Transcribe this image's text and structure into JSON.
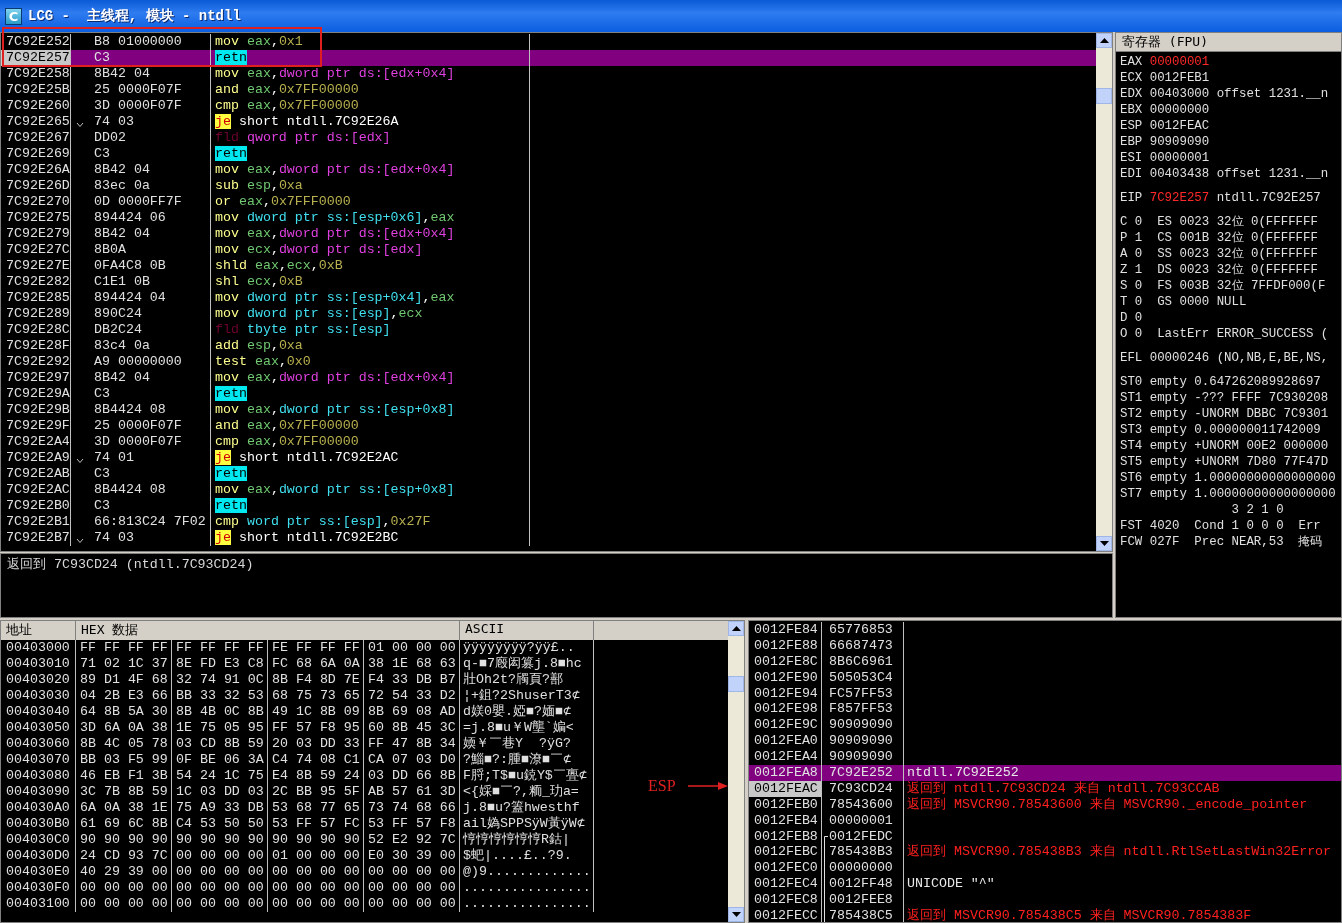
{
  "window": {
    "title": "LCG -  主线程, 模块 - ntdll",
    "icon_letter": "C"
  },
  "disassembly": {
    "rows": [
      {
        "address": "7C92E252",
        "hex": "B8 01000000",
        "boxed": true,
        "selected": false,
        "jump": false,
        "code": [
          {
            "kind": "op",
            "text": "mov"
          },
          {
            "kind": "reg",
            "text": "eax"
          },
          {
            "kind": "punct",
            "text": ","
          },
          {
            "kind": "imm",
            "text": "0x1"
          }
        ]
      },
      {
        "address": "7C92E257",
        "hex": "C3",
        "boxed": true,
        "selected": true,
        "jump": false,
        "code": [
          {
            "kind": "ret",
            "text": "retn"
          }
        ]
      },
      {
        "address": "7C92E258",
        "hex": "8B42 04",
        "boxed": false,
        "selected": false,
        "jump": false,
        "code": [
          {
            "kind": "op",
            "text": "mov"
          },
          {
            "kind": "reg",
            "text": "eax"
          },
          {
            "kind": "punct",
            "text": ","
          },
          {
            "kind": "ds",
            "text": "dword ptr ds:[edx+0x4]"
          }
        ]
      },
      {
        "address": "7C92E25B",
        "hex": "25 0000F07F",
        "boxed": false,
        "selected": false,
        "jump": false,
        "code": [
          {
            "kind": "op",
            "text": "and"
          },
          {
            "kind": "reg",
            "text": "eax"
          },
          {
            "kind": "punct",
            "text": ","
          },
          {
            "kind": "imm",
            "text": "0x7FF00000"
          }
        ]
      },
      {
        "address": "7C92E260",
        "hex": "3D 0000F07F",
        "boxed": false,
        "selected": false,
        "jump": false,
        "code": [
          {
            "kind": "op",
            "text": "cmp"
          },
          {
            "kind": "reg",
            "text": "eax"
          },
          {
            "kind": "punct",
            "text": ","
          },
          {
            "kind": "imm",
            "text": "0x7FF00000"
          }
        ]
      },
      {
        "address": "7C92E265",
        "hex": "74 03",
        "boxed": false,
        "selected": false,
        "jump": true,
        "code": [
          {
            "kind": "jcc",
            "text": "je"
          },
          {
            "kind": "sym",
            "text": "short ntdll.7C92E26A"
          }
        ]
      },
      {
        "address": "7C92E267",
        "hex": "DD02",
        "boxed": false,
        "selected": false,
        "jump": false,
        "code": [
          {
            "kind": "fpu",
            "text": "fld"
          },
          {
            "kind": "ds",
            "text": "qword ptr ds:[edx]"
          }
        ]
      },
      {
        "address": "7C92E269",
        "hex": "C3",
        "boxed": false,
        "selected": false,
        "jump": false,
        "code": [
          {
            "kind": "ret",
            "text": "retn"
          }
        ]
      },
      {
        "address": "7C92E26A",
        "hex": "8B42 04",
        "boxed": false,
        "selected": false,
        "jump": false,
        "code": [
          {
            "kind": "op",
            "text": "mov"
          },
          {
            "kind": "reg",
            "text": "eax"
          },
          {
            "kind": "punct",
            "text": ","
          },
          {
            "kind": "ds",
            "text": "dword ptr ds:[edx+0x4]"
          }
        ]
      },
      {
        "address": "7C92E26D",
        "hex": "83ec 0a",
        "boxed": false,
        "selected": false,
        "jump": false,
        "code": [
          {
            "kind": "op",
            "text": "sub"
          },
          {
            "kind": "reg",
            "text": "esp"
          },
          {
            "kind": "punct",
            "text": ","
          },
          {
            "kind": "imm",
            "text": "0xa"
          }
        ]
      },
      {
        "address": "7C92E270",
        "hex": "0D 0000FF7F",
        "boxed": false,
        "selected": false,
        "jump": false,
        "code": [
          {
            "kind": "op",
            "text": "or"
          },
          {
            "kind": "reg",
            "text": "eax"
          },
          {
            "kind": "punct",
            "text": ","
          },
          {
            "kind": "imm",
            "text": "0x7FFF0000"
          }
        ]
      },
      {
        "address": "7C92E275",
        "hex": "894424 06",
        "boxed": false,
        "selected": false,
        "jump": false,
        "code": [
          {
            "kind": "op",
            "text": "mov"
          },
          {
            "kind": "ss",
            "text": "dword ptr ss:[esp+0x6]"
          },
          {
            "kind": "punct",
            "text": ","
          },
          {
            "kind": "reg",
            "text": "eax"
          }
        ]
      },
      {
        "address": "7C92E279",
        "hex": "8B42 04",
        "boxed": false,
        "selected": false,
        "jump": false,
        "code": [
          {
            "kind": "op",
            "text": "mov"
          },
          {
            "kind": "reg",
            "text": "eax"
          },
          {
            "kind": "punct",
            "text": ","
          },
          {
            "kind": "ds",
            "text": "dword ptr ds:[edx+0x4]"
          }
        ]
      },
      {
        "address": "7C92E27C",
        "hex": "8B0A",
        "boxed": false,
        "selected": false,
        "jump": false,
        "code": [
          {
            "kind": "op",
            "text": "mov"
          },
          {
            "kind": "reg",
            "text": "ecx"
          },
          {
            "kind": "punct",
            "text": ","
          },
          {
            "kind": "ds",
            "text": "dword ptr ds:[edx]"
          }
        ]
      },
      {
        "address": "7C92E27E",
        "hex": "0FA4C8 0B",
        "boxed": false,
        "selected": false,
        "jump": false,
        "code": [
          {
            "kind": "op",
            "text": "shld"
          },
          {
            "kind": "reg",
            "text": "eax"
          },
          {
            "kind": "punct",
            "text": ","
          },
          {
            "kind": "reg",
            "text": "ecx"
          },
          {
            "kind": "punct",
            "text": ","
          },
          {
            "kind": "imm",
            "text": "0xB"
          }
        ]
      },
      {
        "address": "7C92E282",
        "hex": "C1E1 0B",
        "boxed": false,
        "selected": false,
        "jump": false,
        "code": [
          {
            "kind": "op",
            "text": "shl"
          },
          {
            "kind": "reg",
            "text": "ecx"
          },
          {
            "kind": "punct",
            "text": ","
          },
          {
            "kind": "imm",
            "text": "0xB"
          }
        ]
      },
      {
        "address": "7C92E285",
        "hex": "894424 04",
        "boxed": false,
        "selected": false,
        "jump": false,
        "code": [
          {
            "kind": "op",
            "text": "mov"
          },
          {
            "kind": "ss",
            "text": "dword ptr ss:[esp+0x4]"
          },
          {
            "kind": "punct",
            "text": ","
          },
          {
            "kind": "reg",
            "text": "eax"
          }
        ]
      },
      {
        "address": "7C92E289",
        "hex": "890C24",
        "boxed": false,
        "selected": false,
        "jump": false,
        "code": [
          {
            "kind": "op",
            "text": "mov"
          },
          {
            "kind": "ss",
            "text": "dword ptr ss:[esp]"
          },
          {
            "kind": "punct",
            "text": ","
          },
          {
            "kind": "reg",
            "text": "ecx"
          }
        ]
      },
      {
        "address": "7C92E28C",
        "hex": "DB2C24",
        "boxed": false,
        "selected": false,
        "jump": false,
        "code": [
          {
            "kind": "fpu",
            "text": "fld"
          },
          {
            "kind": "ss",
            "text": "tbyte ptr ss:[esp]"
          }
        ]
      },
      {
        "address": "7C92E28F",
        "hex": "83c4 0a",
        "boxed": false,
        "selected": false,
        "jump": false,
        "code": [
          {
            "kind": "op",
            "text": "add"
          },
          {
            "kind": "reg",
            "text": "esp"
          },
          {
            "kind": "punct",
            "text": ","
          },
          {
            "kind": "imm",
            "text": "0xa"
          }
        ]
      },
      {
        "address": "7C92E292",
        "hex": "A9 00000000",
        "boxed": false,
        "selected": false,
        "jump": false,
        "code": [
          {
            "kind": "op",
            "text": "test"
          },
          {
            "kind": "reg",
            "text": "eax"
          },
          {
            "kind": "punct",
            "text": ","
          },
          {
            "kind": "imm",
            "text": "0x0"
          }
        ]
      },
      {
        "address": "7C92E297",
        "hex": "8B42 04",
        "boxed": false,
        "selected": false,
        "jump": false,
        "code": [
          {
            "kind": "op",
            "text": "mov"
          },
          {
            "kind": "reg",
            "text": "eax"
          },
          {
            "kind": "punct",
            "text": ","
          },
          {
            "kind": "ds",
            "text": "dword ptr ds:[edx+0x4]"
          }
        ]
      },
      {
        "address": "7C92E29A",
        "hex": "C3",
        "boxed": false,
        "selected": false,
        "jump": false,
        "code": [
          {
            "kind": "ret",
            "text": "retn"
          }
        ]
      },
      {
        "address": "7C92E29B",
        "hex": "8B4424 08",
        "boxed": false,
        "selected": false,
        "jump": false,
        "code": [
          {
            "kind": "op",
            "text": "mov"
          },
          {
            "kind": "reg",
            "text": "eax"
          },
          {
            "kind": "punct",
            "text": ","
          },
          {
            "kind": "ss",
            "text": "dword ptr ss:[esp+0x8]"
          }
        ]
      },
      {
        "address": "7C92E29F",
        "hex": "25 0000F07F",
        "boxed": false,
        "selected": false,
        "jump": false,
        "code": [
          {
            "kind": "op",
            "text": "and"
          },
          {
            "kind": "reg",
            "text": "eax"
          },
          {
            "kind": "punct",
            "text": ","
          },
          {
            "kind": "imm",
            "text": "0x7FF00000"
          }
        ]
      },
      {
        "address": "7C92E2A4",
        "hex": "3D 0000F07F",
        "boxed": false,
        "selected": false,
        "jump": false,
        "code": [
          {
            "kind": "op",
            "text": "cmp"
          },
          {
            "kind": "reg",
            "text": "eax"
          },
          {
            "kind": "punct",
            "text": ","
          },
          {
            "kind": "imm",
            "text": "0x7FF00000"
          }
        ]
      },
      {
        "address": "7C92E2A9",
        "hex": "74 01",
        "boxed": false,
        "selected": false,
        "jump": true,
        "code": [
          {
            "kind": "jcc",
            "text": "je"
          },
          {
            "kind": "sym",
            "text": "short ntdll.7C92E2AC"
          }
        ]
      },
      {
        "address": "7C92E2AB",
        "hex": "C3",
        "boxed": false,
        "selected": false,
        "jump": false,
        "code": [
          {
            "kind": "ret",
            "text": "retn"
          }
        ]
      },
      {
        "address": "7C92E2AC",
        "hex": "8B4424 08",
        "boxed": false,
        "selected": false,
        "jump": false,
        "code": [
          {
            "kind": "op",
            "text": "mov"
          },
          {
            "kind": "reg",
            "text": "eax"
          },
          {
            "kind": "punct",
            "text": ","
          },
          {
            "kind": "ss",
            "text": "dword ptr ss:[esp+0x8]"
          }
        ]
      },
      {
        "address": "7C92E2B0",
        "hex": "C3",
        "boxed": false,
        "selected": false,
        "jump": false,
        "code": [
          {
            "kind": "ret",
            "text": "retn"
          }
        ]
      },
      {
        "address": "7C92E2B1",
        "hex": "66:813C24 7F02",
        "boxed": false,
        "selected": false,
        "jump": false,
        "code": [
          {
            "kind": "op",
            "text": "cmp"
          },
          {
            "kind": "ss",
            "text": "word ptr ss:[esp]"
          },
          {
            "kind": "punct",
            "text": ","
          },
          {
            "kind": "imm",
            "text": "0x27F"
          }
        ]
      },
      {
        "address": "7C92E2B7",
        "hex": "74 03",
        "boxed": false,
        "selected": false,
        "jump": true,
        "code": [
          {
            "kind": "jcc",
            "text": "je"
          },
          {
            "kind": "sym",
            "text": "short ntdll.7C92E2BC"
          }
        ]
      }
    ]
  },
  "info": "返回到 7C93CD24 (ntdll.7C93CD24)",
  "registers": {
    "title": "寄存器 (FPU)",
    "groups": [
      {
        "lines": [
          {
            "kind": "reg",
            "name": "EAX",
            "value": "00000001",
            "changed": true
          },
          {
            "kind": "reg",
            "name": "ECX",
            "value": "0012FEB1",
            "changed": false
          },
          {
            "kind": "reg",
            "name": "EDX",
            "value": "00403000",
            "changed": false,
            "comment": "offset 1231.__n"
          },
          {
            "kind": "reg",
            "name": "EBX",
            "value": "00000000",
            "changed": false
          },
          {
            "kind": "reg",
            "name": "ESP",
            "value": "0012FEAC",
            "changed": false
          },
          {
            "kind": "reg",
            "name": "EBP",
            "value": "90909090",
            "changed": false
          },
          {
            "kind": "reg",
            "name": "ESI",
            "value": "00000001",
            "changed": false
          },
          {
            "kind": "reg",
            "name": "EDI",
            "value": "00403438",
            "changed": false,
            "comment": "offset 1231.__n"
          }
        ]
      },
      {
        "lines": [
          {
            "kind": "reg",
            "name": "EIP",
            "value": "7C92E257",
            "changed": true,
            "comment": "ntdll.7C92E257"
          }
        ]
      },
      {
        "lines": [
          {
            "kind": "text",
            "text": "C 0  ES 0023 32位 0(FFFFFFF"
          },
          {
            "kind": "text",
            "text": "P 1  CS 001B 32位 0(FFFFFFF"
          },
          {
            "kind": "text",
            "text": "A 0  SS 0023 32位 0(FFFFFFF"
          },
          {
            "kind": "text",
            "text": "Z 1  DS 0023 32位 0(FFFFFFF"
          },
          {
            "kind": "text",
            "text": "S 0  FS 003B 32位 7FFDF000(F"
          },
          {
            "kind": "text",
            "text": "T 0  GS 0000 NULL"
          },
          {
            "kind": "text",
            "text": "D 0"
          },
          {
            "kind": "text",
            "text": "O 0  LastErr ERROR_SUCCESS ("
          }
        ]
      },
      {
        "lines": [
          {
            "kind": "text",
            "text": "EFL 00000246 (NO,NB,E,BE,NS,"
          }
        ]
      },
      {
        "lines": [
          {
            "kind": "text",
            "text": "ST0 empty 0.647262089928697"
          },
          {
            "kind": "text",
            "text": "ST1 empty -??? FFFF 7C930208"
          },
          {
            "kind": "text",
            "text": "ST2 empty -UNORM DBBC 7C9301"
          },
          {
            "kind": "text",
            "text": "ST3 empty 0.000000011742009"
          },
          {
            "kind": "text",
            "text": "ST4 empty +UNORM 00E2 000000"
          },
          {
            "kind": "text",
            "text": "ST5 empty +UNORM 7D80 77F47D"
          },
          {
            "kind": "text",
            "text": "ST6 empty 1.00000000000000000"
          },
          {
            "kind": "text",
            "text": "ST7 empty 1.00000000000000000"
          },
          {
            "kind": "text",
            "text": "               3 2 1 0"
          },
          {
            "kind": "text",
            "text": "FST 4020  Cond 1 0 0 0  Err"
          },
          {
            "kind": "text",
            "text": "FCW 027F  Prec NEAR,53  掩码"
          }
        ]
      }
    ]
  },
  "dump": {
    "columns": [
      "地址",
      "HEX 数据",
      "ASCII"
    ],
    "rows": [
      {
        "address": "00403000",
        "bytes": [
          "FF FF FF FF",
          "FF FF FF FF",
          "FE FF FF FF",
          "01 00 00 00"
        ],
        "ascii": "ÿÿÿÿÿÿÿÿ?ÿÿ£.."
      },
      {
        "address": "00403010",
        "bytes": [
          "71 02 1C 37",
          "8E FD E3 C8",
          "FC 68 6A 0A",
          "38 1E 68 63"
        ],
        "ascii": "q-■7廏闳篡j.8■hc"
      },
      {
        "address": "00403020",
        "bytes": [
          "89 D1 4F 68",
          "32 74 91 0C",
          "8B F4 8D 7E",
          "F4 33 DB B7"
        ],
        "ascii": "壯Oh2t?斶頁?鄯"
      },
      {
        "address": "00403030",
        "bytes": [
          "04 2B E3 66",
          "BB 33 32 53",
          "68 75 73 65",
          "72 54 33 D2"
        ],
        "ascii": "¦+鉏?2ShuserT3⊄"
      },
      {
        "address": "00403040",
        "bytes": [
          "64 8B 5A 30",
          "8B 4B 0C 8B",
          "49 1C 8B 09",
          "8B 69 08 AD"
        ],
        "ascii": "d媄0嬰.婭■?媔■⊄"
      },
      {
        "address": "00403050",
        "bytes": [
          "3D 6A 0A 38",
          "1E 75 05 95",
          "FF 57 F8 95",
          "60 8B 45 3C"
        ],
        "ascii": "=j.8■u￥W壟`媥<"
      },
      {
        "address": "00403060",
        "bytes": [
          "8B 4C 05 78",
          "03 CD 8B 59",
          "20 03 DD 33",
          "FF 47 8B 34"
        ],
        "ascii": "媆￥￣巷Y  ?ÿG?"
      },
      {
        "address": "00403070",
        "bytes": [
          "BB 03 F5 99",
          "0F BE 06 3A",
          "C4 74 08 C1",
          "CA 07 03 D0"
        ],
        "ascii": "?鯔■?:腫■潦■￣⊄"
      },
      {
        "address": "00403080",
        "bytes": [
          "46 EB F1 3B",
          "54 24 1C 75",
          "E4 8B 59 24",
          "03 DD 66 8B"
        ],
        "ascii": "F脟;T$■u鋴Y$￣亹⊄"
      },
      {
        "address": "00403090",
        "bytes": [
          "3C 7B 8B 59",
          "1C 03 DD 03",
          "2C BB 95 5F",
          "AB 57 61 3D"
        ],
        "ascii": "<{婇■￣?,粫_玏a="
      },
      {
        "address": "004030A0",
        "bytes": [
          "6A 0A 38 1E",
          "75 A9 33 DB",
          "53 68 77 65",
          "73 74 68 66"
        ],
        "ascii": "j.8■u?篕hwesthf"
      },
      {
        "address": "004030B0",
        "bytes": [
          "61 69 6C 8B",
          "C4 53 50 50",
          "53 FF 57 FC",
          "53 FF 57 F8"
        ],
        "ascii": "ail媯SPPSÿW黃ÿW⊄"
      },
      {
        "address": "004030C0",
        "bytes": [
          "90 90 90 90",
          "90 90 90 90",
          "90 90 90 90",
          "52 E2 92 7C"
        ],
        "ascii": "悙悙悙悙悙悙R鈷|"
      },
      {
        "address": "004030D0",
        "bytes": [
          "24 CD 93 7C",
          "00 00 00 00",
          "01 00 00 00",
          "E0 30 39 00"
        ],
        "ascii": "$蚆|....£..?9."
      },
      {
        "address": "004030E0",
        "bytes": [
          "40 29 39 00",
          "00 00 00 00",
          "00 00 00 00",
          "00 00 00 00"
        ],
        "ascii": "@)9............."
      },
      {
        "address": "004030F0",
        "bytes": [
          "00 00 00 00",
          "00 00 00 00",
          "00 00 00 00",
          "00 00 00 00"
        ],
        "ascii": "................"
      },
      {
        "address": "00403100",
        "bytes": [
          "00 00 00 00",
          "00 00 00 00",
          "00 00 00 00",
          "00 00 00 00"
        ],
        "ascii": "................"
      }
    ]
  },
  "stack": {
    "pointer_label": "ESP",
    "rows": [
      {
        "address": "0012FE84",
        "value": "65776853",
        "selected": false,
        "current": false,
        "frame": false
      },
      {
        "address": "0012FE88",
        "value": "66687473",
        "selected": false,
        "current": false,
        "frame": false
      },
      {
        "address": "0012FE8C",
        "value": "8B6C6961",
        "selected": false,
        "current": false,
        "frame": false
      },
      {
        "address": "0012FE90",
        "value": "505053C4",
        "selected": false,
        "current": false,
        "frame": false
      },
      {
        "address": "0012FE94",
        "value": "FC57FF53",
        "selected": false,
        "current": false,
        "frame": false
      },
      {
        "address": "0012FE98",
        "value": "F857FF53",
        "selected": false,
        "current": false,
        "frame": false
      },
      {
        "address": "0012FE9C",
        "value": "90909090",
        "selected": false,
        "current": false,
        "frame": false
      },
      {
        "address": "0012FEA0",
        "value": "90909090",
        "selected": false,
        "current": false,
        "frame": false
      },
      {
        "address": "0012FEA4",
        "value": "90909090",
        "selected": false,
        "current": false,
        "frame": false
      },
      {
        "address": "0012FEA8",
        "value": "7C92E252",
        "selected": true,
        "current": false,
        "frame": false,
        "kind": "plain",
        "comment": "ntdll.7C92E252"
      },
      {
        "address": "0012FEAC",
        "value": "7C93CD24",
        "selected": false,
        "current": true,
        "frame": false,
        "kind": "return",
        "comment": "返回到 ntdll.7C93CD24 来自 ntdll.7C93CCAB"
      },
      {
        "address": "0012FEB0",
        "value": "78543600",
        "selected": false,
        "current": false,
        "frame": false,
        "kind": "return",
        "comment": "返回到 MSVCR90.78543600 来自 MSVCR90._encode_pointer"
      },
      {
        "address": "0012FEB4",
        "value": "00000001",
        "selected": false,
        "current": false,
        "frame": false
      },
      {
        "address": "0012FEB8",
        "value": "0012FEDC",
        "selected": false,
        "current": false,
        "frame": true
      },
      {
        "address": "0012FEBC",
        "value": "785438B3",
        "selected": false,
        "current": false,
        "frame": true,
        "kind": "return",
        "comment": "返回到 MSVCR90.785438B3 来自 ntdll.RtlSetLastWin32Error"
      },
      {
        "address": "0012FEC0",
        "value": "00000000",
        "selected": false,
        "current": false,
        "frame": true
      },
      {
        "address": "0012FEC4",
        "value": "0012FF48",
        "selected": false,
        "current": false,
        "frame": true,
        "kind": "plain",
        "comment": "UNICODE \"^\""
      },
      {
        "address": "0012FEC8",
        "value": "0012FEE8",
        "selected": false,
        "current": false,
        "frame": true
      },
      {
        "address": "0012FECC",
        "value": "785438C5",
        "selected": false,
        "current": false,
        "frame": true,
        "kind": "return",
        "comment": "返回到 MSVCR90.785438C5 来自 MSVCR90.7854383F"
      }
    ]
  }
}
